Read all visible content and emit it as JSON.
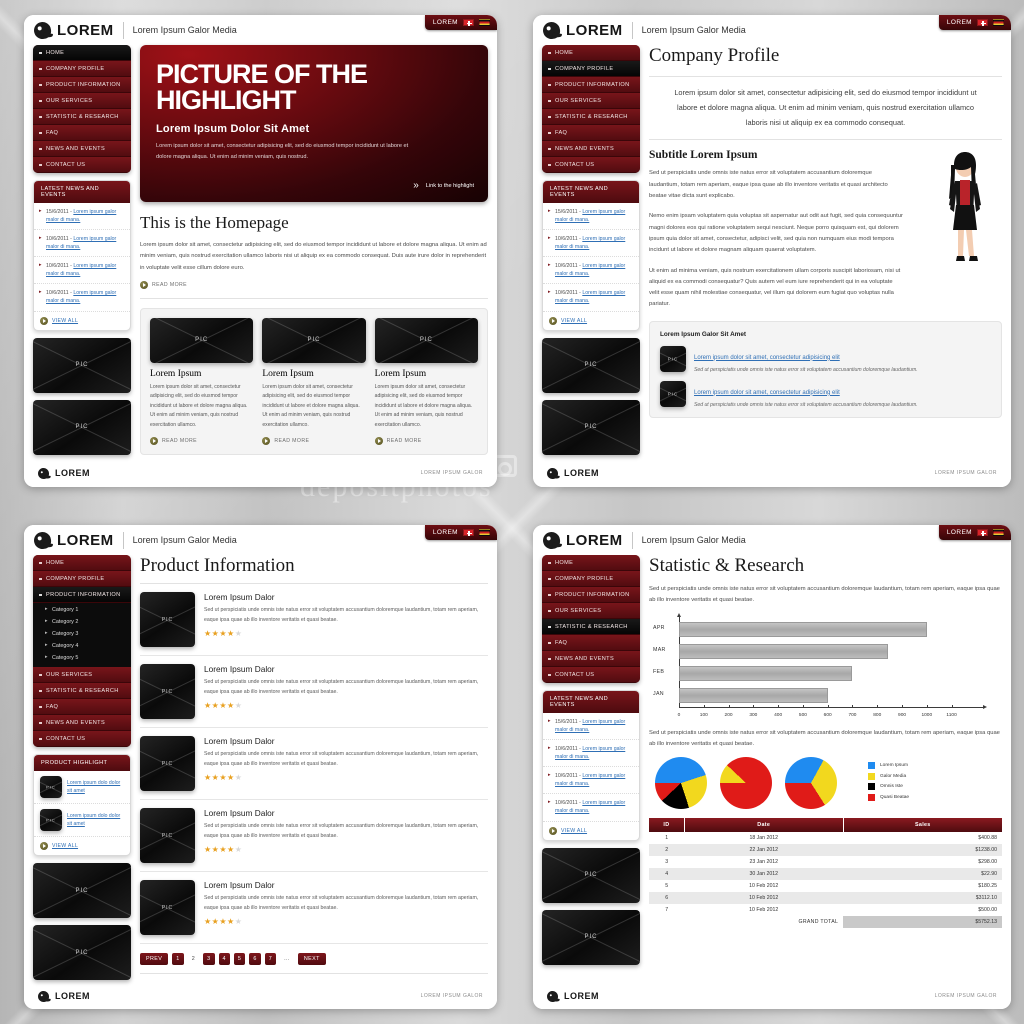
{
  "brand": {
    "logo_text": "LOREM",
    "tagline": "Lorem Ipsum Galor Media",
    "lang_label": "LOREM",
    "footer_note": "LOREM IPSUM GALOR"
  },
  "nav": {
    "items": [
      {
        "label": "HOME"
      },
      {
        "label": "COMPANY PROFILE"
      },
      {
        "label": "PRODUCT INFORMATION"
      },
      {
        "label": "OUR SERVICES"
      },
      {
        "label": "STATISTIC & RESEARCH"
      },
      {
        "label": "FAQ"
      },
      {
        "label": "NEWS AND EVENTS"
      },
      {
        "label": "CONTACT US"
      }
    ],
    "categories": [
      "Category 1",
      "Category 2",
      "Category 3",
      "Category 4",
      "Category 5"
    ]
  },
  "news_widget": {
    "title": "LATEST NEWS AND EVENTS",
    "items": [
      {
        "date": "15/6/2011 - ",
        "link": "Lorem ipsum galor malor di mana."
      },
      {
        "date": "10/6/2011 - ",
        "link": "Lorem ipsum galor malor di mana."
      },
      {
        "date": "10/6/2011 - ",
        "link": "Lorem ipsum galor malor di mana."
      },
      {
        "date": "10/6/2011 - ",
        "link": "Lorem ipsum galor malor di mana."
      }
    ],
    "view_all": "VIEW ALL"
  },
  "pic_placeholder": "PIC",
  "page1": {
    "hero": {
      "title_line1": "PICTURE OF THE",
      "title_line2": "HIGHLIGHT",
      "subtitle": "Lorem Ipsum Dolor Sit Amet",
      "body": "Lorem ipsum dolor sit amet, consectetur adipisicing elit, sed do eiusmod tempor incididunt ut labore et dolore magna aliqua. Ut enim ad minim veniam, quis nostrud.",
      "link": "Link to the highlight"
    },
    "heading": "This is the Homepage",
    "intro": "Lorem ipsum dolor sit amet, consectetur adipisicing elit, sed do eiusmod tempor incididunt ut labore et dolore magna aliqua. Ut enim ad minim veniam, quis nostrud exercitation ullamco laboris nisi ut aliquip ex ea commodo consequat. Duis aute irure dolor in reprehenderit in voluptate velit esse cillum dolore euro.",
    "read_more": "READ MORE",
    "cards": [
      {
        "title": "Lorem Ipsum",
        "body": "Lorem ipsum dolor sit amet, consectetur adipisicing elit, sed do eiusmod tempor incididunt ut labore et dolore magna aliqua. Ut enim ad minim veniam, quis nostrud exercitation ullamco.",
        "read_more": "READ MORE"
      },
      {
        "title": "Lorem Ipsum",
        "body": "Lorem ipsum dolor sit amet, consectetur adipisicing elit, sed do eiusmod tempor incididunt ut labore et dolore magna aliqua. Ut enim ad minim veniam, quis nostrud exercitation ullamco.",
        "read_more": "READ MORE"
      },
      {
        "title": "Lorem Ipsum",
        "body": "Lorem ipsum dolor sit amet, consectetur adipisicing elit, sed do eiusmod tempor incididunt ut labore et dolore magna aliqua. Ut enim ad minim veniam, quis nostrud exercitation ullamco.",
        "read_more": "READ MORE"
      }
    ]
  },
  "page2": {
    "heading": "Company Profile",
    "lead": "Lorem ipsum dolor sit amet, consectetur adipisicing elit, sed do eiusmod tempor incididunt ut labore et dolore magna aliqua. Ut enim ad minim veniam, quis nostrud exercitation ullamco laboris nisi ut aliquip ex ea commodo consequat.",
    "subtitle": "Subtitle Lorem Ipsum",
    "para1": "Sed ut perspiciatis unde omnis iste natus error sit voluptatem accusantium doloremque laudantium, totam rem aperiam, eaque ipsa quae ab illo inventore veritatis et quasi architecto beatae vitae dicta sunt explicabo.",
    "para2": "Nemo enim ipsam voluptatem quia voluptas sit aspernatur aut odit aut fugit, sed quia consequuntur magni dolores eos qui ratione voluptatem sequi nesciunt. Neque porro quisquam est, qui dolorem ipsum quia dolor sit amet, consectetur, adipisci velit, sed quia non numquam eius modi tempora incidunt ut labore et dolore magnam aliquam quaerat voluptatem.",
    "para3": "Ut enim ad minima veniam, quis nostrum exercitationem ullam corporis suscipit laboriosam, nisi ut aliquid ex ea commodi consequatur? Quis autem vel eum iure reprehenderit qui in ea voluptate velit esse quam nihil molestiae consequatur, vel illum qui dolorem eum fugiat quo voluptas nulla pariatur.",
    "link_box": {
      "title": "Lorem Ipsum Galor Sit Amet",
      "rows": [
        {
          "link": "Lorem ipsum dolor sit amet, consectetur adipisicing elit",
          "desc": "Sed ut perspiciatis unde omnis iste natus error sit voluptatem accusantium doloremque laudantium."
        },
        {
          "link": "Lorem ipsum dolor sit amet, consectetur adipisicing elit",
          "desc": "Sed ut perspiciatis unde omnis iste natus error sit voluptatem accusantium doloremque laudantium."
        }
      ]
    }
  },
  "page3": {
    "heading": "Product Information",
    "products": [
      {
        "title": "Lorem Ipsum Dalor",
        "body": "Sed ut perspiciatis unde omnis iste natus error sit voluptatem accusantium doloremque laudantium, totam rem aperiam, eaque ipsa quae ab illo inventore veritatis et quasi beatae.",
        "rating": 3.5
      },
      {
        "title": "Lorem Ipsum Dalor",
        "body": "Sed ut perspiciatis unde omnis iste natus error sit voluptatem accusantium doloremque laudantium, totam rem aperiam, eaque ipsa quae ab illo inventore veritatis et quasi beatae.",
        "rating": 3.5
      },
      {
        "title": "Lorem Ipsum Dalor",
        "body": "Sed ut perspiciatis unde omnis iste natus error sit voluptatem accusantium doloremque laudantium, totam rem aperiam, eaque ipsa quae ab illo inventore veritatis et quasi beatae.",
        "rating": 3.5
      },
      {
        "title": "Lorem Ipsum Dalor",
        "body": "Sed ut perspiciatis unde omnis iste natus error sit voluptatem accusantium doloremque laudantium, totam rem aperiam, eaque ipsa quae ab illo inventore veritatis et quasi beatae.",
        "rating": 3.5
      },
      {
        "title": "Lorem Ipsum Dalor",
        "body": "Sed ut perspiciatis unde omnis iste natus error sit voluptatem accusantium doloremque laudantium, totam rem aperiam, eaque ipsa quae ab illo inventore veritatis et quasi beatae.",
        "rating": 3.5
      }
    ],
    "pager": {
      "prev": "PREV",
      "next": "NEXT",
      "pages": [
        "1",
        "2",
        "3",
        "4",
        "5",
        "6",
        "7"
      ],
      "ellipsis": "...",
      "current": "2"
    },
    "highlight_widget": {
      "title": "PRODUCT HIGHLIGHT",
      "items": [
        {
          "link": "Lorem ipsum dolo dolor sit amet"
        },
        {
          "link": "Lorem ipsum dolo dolor sit amet"
        }
      ],
      "view_all": "VIEW ALL"
    }
  },
  "page4": {
    "heading": "Statistic & Research",
    "intro": "Sed ut perspiciatis unde omnis iste natus error sit voluptatem accusantium doloremque laudantium, totam rem aperiam, eaque ipsa quae ab illo inventore veritatis et quasi beatae.",
    "mid_text": "Sed ut perspiciatis unde omnis iste natus error sit voluptatem accusantium doloremque laudantium, totam rem aperiam, eaque ipsa quae ab illo inventore veritatis et quasi beatae.",
    "table": {
      "columns": [
        "ID",
        "Date",
        "Sales"
      ],
      "rows": [
        {
          "id": "1",
          "date": "18 Jan 2012",
          "sales": "$400.88"
        },
        {
          "id": "2",
          "date": "22 Jan 2012",
          "sales": "$1238.00"
        },
        {
          "id": "3",
          "date": "23 Jan 2012",
          "sales": "$298.00"
        },
        {
          "id": "4",
          "date": "30 Jan 2012",
          "sales": "$22.90"
        },
        {
          "id": "5",
          "date": "10 Feb 2012",
          "sales": "$180.25"
        },
        {
          "id": "6",
          "date": "10 Feb 2012",
          "sales": "$3112.10"
        },
        {
          "id": "7",
          "date": "10 Feb 2012",
          "sales": "$500.00"
        }
      ],
      "grand_total_label": "GRAND TOTAL",
      "grand_total_value": "$5752.13"
    }
  },
  "chart_data": [
    {
      "type": "bar",
      "orientation": "horizontal",
      "title": "",
      "categories": [
        "JAN",
        "FEB",
        "MAR",
        "APR"
      ],
      "values": [
        600,
        700,
        845,
        1000
      ],
      "xlabel": "",
      "ylabel": "",
      "xlim": [
        0,
        1150
      ],
      "ticks": [
        0,
        100,
        200,
        300,
        400,
        500,
        600,
        700,
        800,
        900,
        1000,
        1100
      ],
      "grid": false,
      "bar_color": "#b4b4b4"
    },
    {
      "type": "pie",
      "title": "",
      "labels": [
        "Lorem Ipsum",
        "Galor Media",
        "Omnis Iste",
        "Quasi Beatae"
      ],
      "colors": [
        "#1f8bf0",
        "#f2d81e",
        "#000000",
        "#e01b18"
      ],
      "values": [
        45,
        25,
        18,
        12
      ],
      "legend": "right"
    },
    {
      "type": "pie",
      "title": "",
      "labels": [
        "Lorem Ipsum",
        "Galor Media",
        "Omnis Iste",
        "Quasi Beatae"
      ],
      "colors": [
        "#1f8bf0",
        "#f2d81e",
        "#000000",
        "#e01b18"
      ],
      "values": [
        0,
        12,
        0,
        88
      ],
      "legend": "none"
    },
    {
      "type": "pie",
      "title": "",
      "labels": [
        "Lorem Ipsum",
        "Galor Media",
        "Omnis Iste",
        "Quasi Beatae"
      ],
      "colors": [
        "#1f8bf0",
        "#f2d81e",
        "#000000",
        "#e01b18"
      ],
      "values": [
        33,
        33,
        0,
        34
      ],
      "legend": "none"
    }
  ]
}
